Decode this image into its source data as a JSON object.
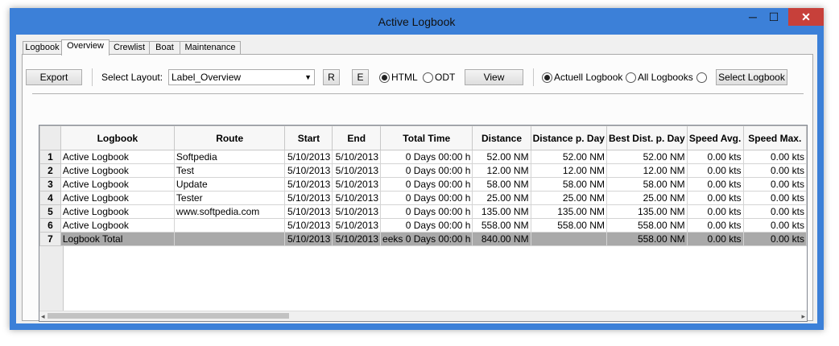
{
  "window": {
    "title": "Active Logbook",
    "min": "─",
    "max": "☐",
    "close": "✕"
  },
  "tabs": [
    "Logbook",
    "Overview",
    "Crewlist",
    "Boat",
    "Maintenance"
  ],
  "toolbar": {
    "export": "Export",
    "select_layout_label": "Select Layout:",
    "layout_value": "Label_Overview",
    "r": "R",
    "e": "E",
    "html": "HTML",
    "odt": "ODT",
    "view": "View",
    "actuell": "Actuell Logbook",
    "all": "All Logbooks",
    "select_logbook": "Select Logbook"
  },
  "grid": {
    "columns": [
      "Logbook",
      "Route",
      "Start",
      "End",
      "Total Time",
      "Distance",
      "Distance p. Day",
      "Best Dist. p. Day",
      "Speed Avg.",
      "Speed Max."
    ],
    "rows": [
      {
        "n": "1",
        "logbook": "Active Logbook",
        "route": "Softpedia",
        "start": "5/10/2013",
        "end": "5/10/2013",
        "total": "0 Days 00:00 h",
        "dist": "52.00 NM",
        "dpd": "52.00 NM",
        "best": "52.00 NM",
        "avg": "0.00 kts",
        "max": "0.00 kts"
      },
      {
        "n": "2",
        "logbook": "Active Logbook",
        "route": "Test",
        "start": "5/10/2013",
        "end": "5/10/2013",
        "total": "0 Days 00:00 h",
        "dist": "12.00 NM",
        "dpd": "12.00 NM",
        "best": "12.00 NM",
        "avg": "0.00 kts",
        "max": "0.00 kts"
      },
      {
        "n": "3",
        "logbook": "Active Logbook",
        "route": "Update",
        "start": "5/10/2013",
        "end": "5/10/2013",
        "total": "0 Days 00:00 h",
        "dist": "58.00 NM",
        "dpd": "58.00 NM",
        "best": "58.00 NM",
        "avg": "0.00 kts",
        "max": "0.00 kts"
      },
      {
        "n": "4",
        "logbook": "Active Logbook",
        "route": "Tester",
        "start": "5/10/2013",
        "end": "5/10/2013",
        "total": "0 Days 00:00 h",
        "dist": "25.00 NM",
        "dpd": "25.00 NM",
        "best": "25.00 NM",
        "avg": "0.00 kts",
        "max": "0.00 kts"
      },
      {
        "n": "5",
        "logbook": "Active Logbook",
        "route": "www.softpedia.com",
        "start": "5/10/2013",
        "end": "5/10/2013",
        "total": "0 Days 00:00 h",
        "dist": "135.00 NM",
        "dpd": "135.00 NM",
        "best": "135.00 NM",
        "avg": "0.00 kts",
        "max": "0.00 kts"
      },
      {
        "n": "6",
        "logbook": "Active Logbook",
        "route": "",
        "start": "5/10/2013",
        "end": "5/10/2013",
        "total": "0 Days 00:00 h",
        "dist": "558.00 NM",
        "dpd": "558.00 NM",
        "best": "558.00 NM",
        "avg": "0.00 kts",
        "max": "0.00 kts"
      },
      {
        "n": "7",
        "logbook": "Logbook Total",
        "route": "",
        "start": "5/10/2013",
        "end": "5/10/2013",
        "total": "eeks 0 Days 00:00 h",
        "dist": "840.00 NM",
        "dpd": "",
        "best": "558.00 NM",
        "avg": "0.00 kts",
        "max": "0.00 kts"
      }
    ]
  },
  "scroll": {
    "left": "◂",
    "right": "▸"
  }
}
